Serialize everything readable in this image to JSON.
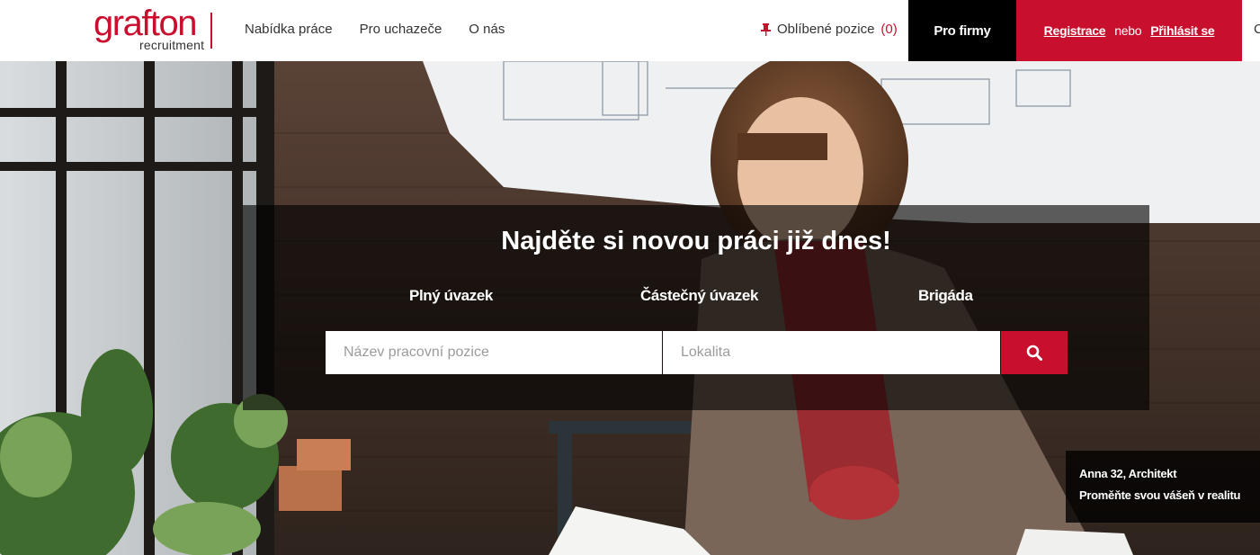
{
  "brand": {
    "name": "grafton",
    "sub": "recruitment",
    "color": "#c8102e"
  },
  "nav": {
    "items": [
      {
        "label": "Nabídka práce"
      },
      {
        "label": "Pro uchazeče"
      },
      {
        "label": "O nás"
      }
    ]
  },
  "favorites": {
    "label": "Oblíbené pozice",
    "count": "(0)",
    "icon": "pin-icon"
  },
  "pro_firmy": {
    "label": "Pro firmy"
  },
  "auth": {
    "register": "Registrace",
    "or": "nebo",
    "login": "Přihlásit se"
  },
  "lang_peek": "C",
  "hero": {
    "headline": "Najděte si novou práci již dnes!",
    "job_types": [
      "Plný úvazek",
      "Částečný úvazek",
      "Brigáda"
    ],
    "search": {
      "position_placeholder": "Název pracovní pozice",
      "location_placeholder": "Lokalita",
      "button_icon": "search-icon"
    },
    "caption": {
      "line1": "Anna 32, Architekt",
      "line2": "Proměňte svou vášeň v realitu"
    }
  },
  "colors": {
    "accent": "#c8102e",
    "dark": "#000000"
  }
}
